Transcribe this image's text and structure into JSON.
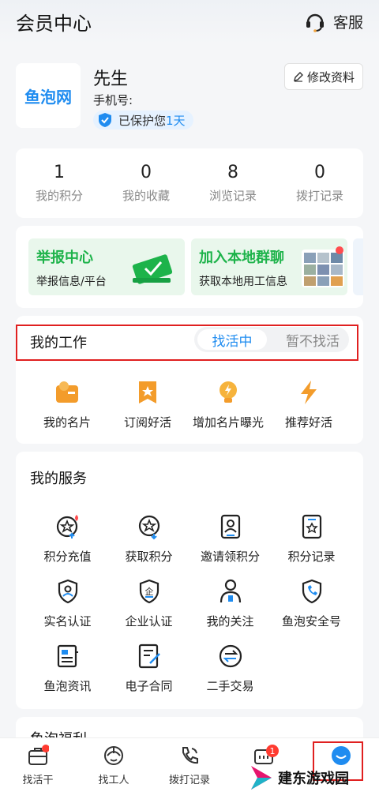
{
  "header": {
    "title": "会员中心",
    "customer_service": "客服"
  },
  "profile": {
    "logo_text": "鱼泡网",
    "name": "先生",
    "phone_label": "手机号:",
    "protect_prefix": "已保护您",
    "protect_days": "1天",
    "edit_button": "修改资料"
  },
  "stats": [
    {
      "value": "1",
      "label": "我的积分"
    },
    {
      "value": "0",
      "label": "我的收藏"
    },
    {
      "value": "8",
      "label": "浏览记录"
    },
    {
      "value": "0",
      "label": "拨打记录"
    }
  ],
  "banners": [
    {
      "title": "举报中心",
      "subtitle": "举报信息/平台"
    },
    {
      "title": "加入本地群聊",
      "subtitle": "获取本地用工信息"
    }
  ],
  "work": {
    "title": "我的工作",
    "toggle_on": "找活中",
    "toggle_off": "暂不找活",
    "items": [
      {
        "label": "我的名片",
        "icon": "card-icon"
      },
      {
        "label": "订阅好活",
        "icon": "bookmark-star-icon"
      },
      {
        "label": "增加名片曝光",
        "icon": "bulb-icon"
      },
      {
        "label": "推荐好活",
        "icon": "lightning-icon"
      }
    ]
  },
  "services": {
    "title": "我的服务",
    "items": [
      {
        "label": "积分充值",
        "icon": "points-recharge-icon"
      },
      {
        "label": "获取积分",
        "icon": "get-points-icon"
      },
      {
        "label": "邀请领积分",
        "icon": "invite-points-icon"
      },
      {
        "label": "积分记录",
        "icon": "points-record-icon"
      },
      {
        "label": "实名认证",
        "icon": "id-verify-icon"
      },
      {
        "label": "企业认证",
        "icon": "company-verify-icon"
      },
      {
        "label": "我的关注",
        "icon": "follow-icon"
      },
      {
        "label": "鱼泡安全号",
        "icon": "safe-phone-icon"
      },
      {
        "label": "鱼泡资讯",
        "icon": "news-icon"
      },
      {
        "label": "电子合同",
        "icon": "contract-icon"
      },
      {
        "label": "二手交易",
        "icon": "trade-icon"
      }
    ]
  },
  "partial_section_title": "鱼泡福利",
  "tabbar": [
    {
      "label": "找活干",
      "icon": "briefcase-icon"
    },
    {
      "label": "找工人",
      "icon": "helmet-icon"
    },
    {
      "label": "拨打记录",
      "icon": "phone-icon"
    },
    {
      "label": "",
      "icon": "message-icon",
      "badge": "1"
    },
    {
      "label": "",
      "icon": "profile-icon"
    }
  ],
  "watermark": "建东游戏园",
  "colors": {
    "accent": "#1f8cf0",
    "green": "#1db34a",
    "highlight": "#e02020"
  }
}
